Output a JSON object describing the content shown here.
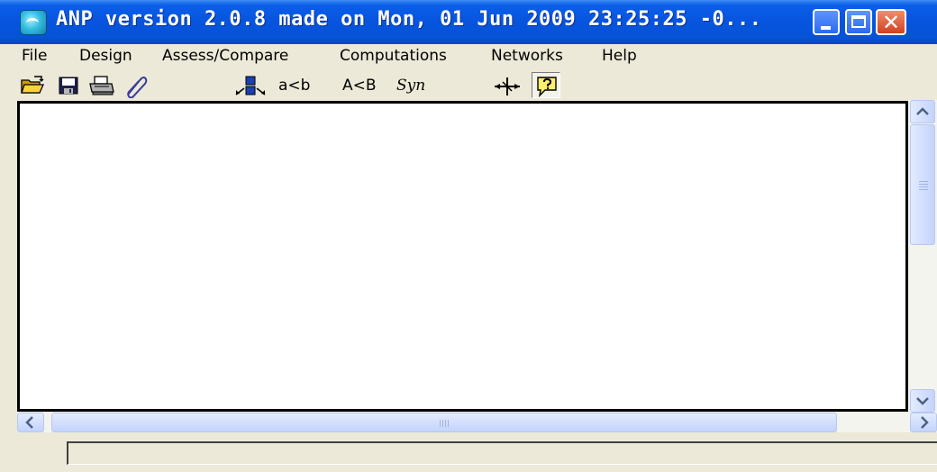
{
  "window": {
    "title": "ANP version 2.0.8 made on Mon, 01 Jun 2009 23:25:25 -0...",
    "icon": "anp-app-icon",
    "controls": [
      "minimize",
      "maximize",
      "close"
    ],
    "close_glyph": "✕"
  },
  "menu": {
    "items": [
      "File",
      "Design",
      "Assess/Compare",
      "Computations",
      "Networks",
      "Help"
    ]
  },
  "toolbar": {
    "icons": [
      "open-folder-icon",
      "save-disk-icon",
      "print-icon",
      "attach-paperclip-icon",
      "hierarchy-icon",
      "compass-icon",
      "help-question-icon"
    ],
    "compare_lower_label": "a<b",
    "compare_upper_label": "A<B",
    "synthesize_label": "Syn"
  },
  "status": {
    "text": ""
  },
  "colors": {
    "titlebar": "#0754de",
    "chrome": "#ece9d8",
    "canvas": "#ffffff",
    "close": "#d2401f"
  }
}
